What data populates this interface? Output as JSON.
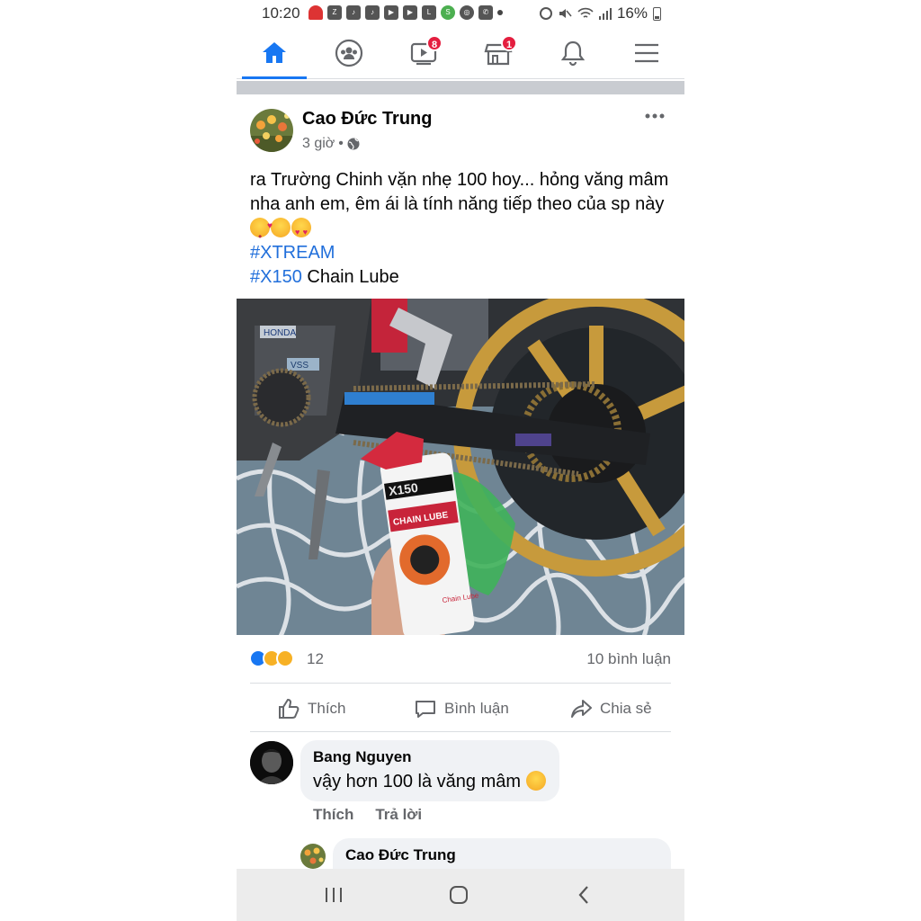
{
  "status_bar": {
    "time": "10:20",
    "battery": "16%",
    "notification_icons": [
      "missed-call-icon",
      "zalo-icon",
      "tiktok-icon",
      "tiktok-icon",
      "youtube-icon",
      "youtube-icon",
      "lazada-icon",
      "shopee-icon",
      "vpn-icon",
      "missed-call-icon",
      "dot-icon"
    ],
    "system_icons": [
      "alarm-icon",
      "mute-icon",
      "wifi-icon",
      "signal-icon",
      "battery-icon"
    ]
  },
  "nav": {
    "tabs": [
      {
        "name": "home",
        "icon": "home-icon",
        "active": true
      },
      {
        "name": "groups",
        "icon": "groups-icon",
        "active": false
      },
      {
        "name": "watch",
        "icon": "watch-icon",
        "badge": "8",
        "active": false
      },
      {
        "name": "marketplace",
        "icon": "marketplace-icon",
        "badge": "1",
        "active": false
      },
      {
        "name": "notifications",
        "icon": "bell-icon",
        "active": false
      },
      {
        "name": "menu",
        "icon": "menu-icon",
        "active": false
      }
    ],
    "accent": "#1877f2",
    "badge_color": "#e41e3f"
  },
  "post": {
    "author": "Cao Đức Trung",
    "time": "3 giờ",
    "separator": "•",
    "privacy_icon": "globe-icon",
    "text_line1": "ra Trường Chinh vặn nhẹ 100 hoy... hỏng văng mâm nha anh em, êm ái là tính năng tiếp theo của sp này",
    "hashtag1": "#XTREAM",
    "hashtag2": "#X150",
    "hashtag2_suffix": " Chain Lube",
    "image_text": {
      "can_brand": "X150",
      "can_label": "CHAIN LUBE",
      "can_side": "Chain Lube",
      "tank_sticker": "HONDA",
      "plate": "VSS"
    },
    "reactions": {
      "icons": [
        "like-icon",
        "haha-icon",
        "care-icon"
      ],
      "count": "12",
      "comments": "10 bình luận"
    },
    "actions": {
      "like": "Thích",
      "comment": "Bình luận",
      "share": "Chia sẻ"
    }
  },
  "comments": [
    {
      "author": "Bang Nguyen",
      "text": "vậy hơn 100 là văng mâm",
      "emoji": "laughing-tears-icon",
      "like_label": "Thích",
      "reply_label": "Trả lời"
    },
    {
      "author": "Cao Đức Trung"
    }
  ],
  "system_nav": {
    "buttons": [
      "recent-apps-icon",
      "home-button-icon",
      "back-icon"
    ]
  }
}
